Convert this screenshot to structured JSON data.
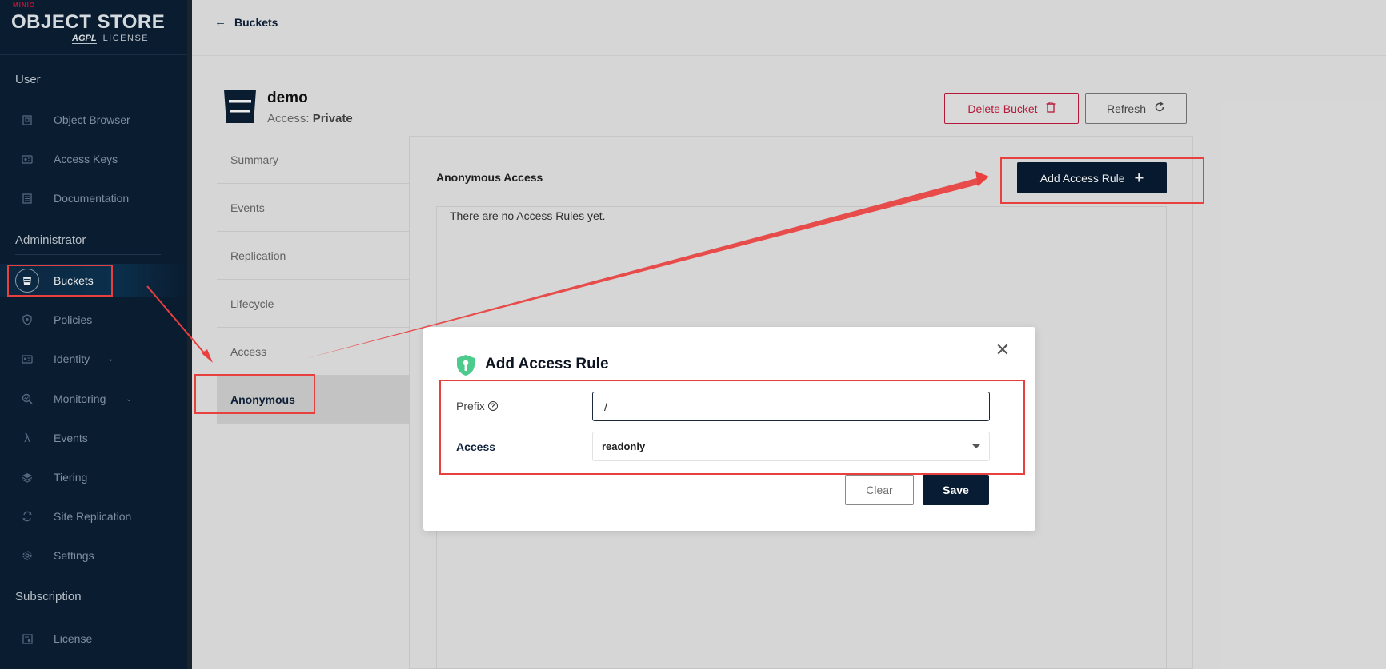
{
  "brand": {
    "minio": "MINIO",
    "product": "OBJECT STORE",
    "agpl": "AGPL",
    "license": "LICENSE"
  },
  "sidebar": {
    "sections": [
      {
        "title": "User"
      },
      {
        "title": "Administrator"
      },
      {
        "title": "Subscription"
      }
    ],
    "items": [
      {
        "label": "Object Browser",
        "icon": "object-browser-icon"
      },
      {
        "label": "Access Keys",
        "icon": "access-keys-icon"
      },
      {
        "label": "Documentation",
        "icon": "documentation-icon"
      },
      {
        "label": "Buckets",
        "icon": "bucket-icon"
      },
      {
        "label": "Policies",
        "icon": "policies-icon"
      },
      {
        "label": "Identity",
        "icon": "identity-icon"
      },
      {
        "label": "Monitoring",
        "icon": "monitoring-icon"
      },
      {
        "label": "Events",
        "icon": "lambda-icon"
      },
      {
        "label": "Tiering",
        "icon": "tiering-icon"
      },
      {
        "label": "Site Replication",
        "icon": "site-replication-icon"
      },
      {
        "label": "Settings",
        "icon": "gear-icon"
      },
      {
        "label": "License",
        "icon": "license-icon"
      }
    ]
  },
  "header": {
    "back_label": "Buckets"
  },
  "bucket": {
    "name": "demo",
    "access_label": "Access:",
    "access_value": "Private",
    "delete_label": "Delete Bucket",
    "refresh_label": "Refresh"
  },
  "tabs": [
    {
      "label": "Summary"
    },
    {
      "label": "Events"
    },
    {
      "label": "Replication"
    },
    {
      "label": "Lifecycle"
    },
    {
      "label": "Access"
    },
    {
      "label": "Anonymous"
    }
  ],
  "anonymous": {
    "title": "Anonymous Access",
    "add_rule_label": "Add Access Rule",
    "empty_text": "There are no Access Rules yet."
  },
  "modal": {
    "title": "Add Access Rule",
    "prefix_label": "Prefix",
    "prefix_value": "/",
    "access_label": "Access",
    "access_value": "readonly",
    "clear_label": "Clear",
    "save_label": "Save"
  },
  "colors": {
    "sidebar_bg": "#0b1f35",
    "primary": "#081c33",
    "danger": "#c51c3e",
    "annotation": "#e8403f",
    "shield": "#4ccb8d"
  }
}
